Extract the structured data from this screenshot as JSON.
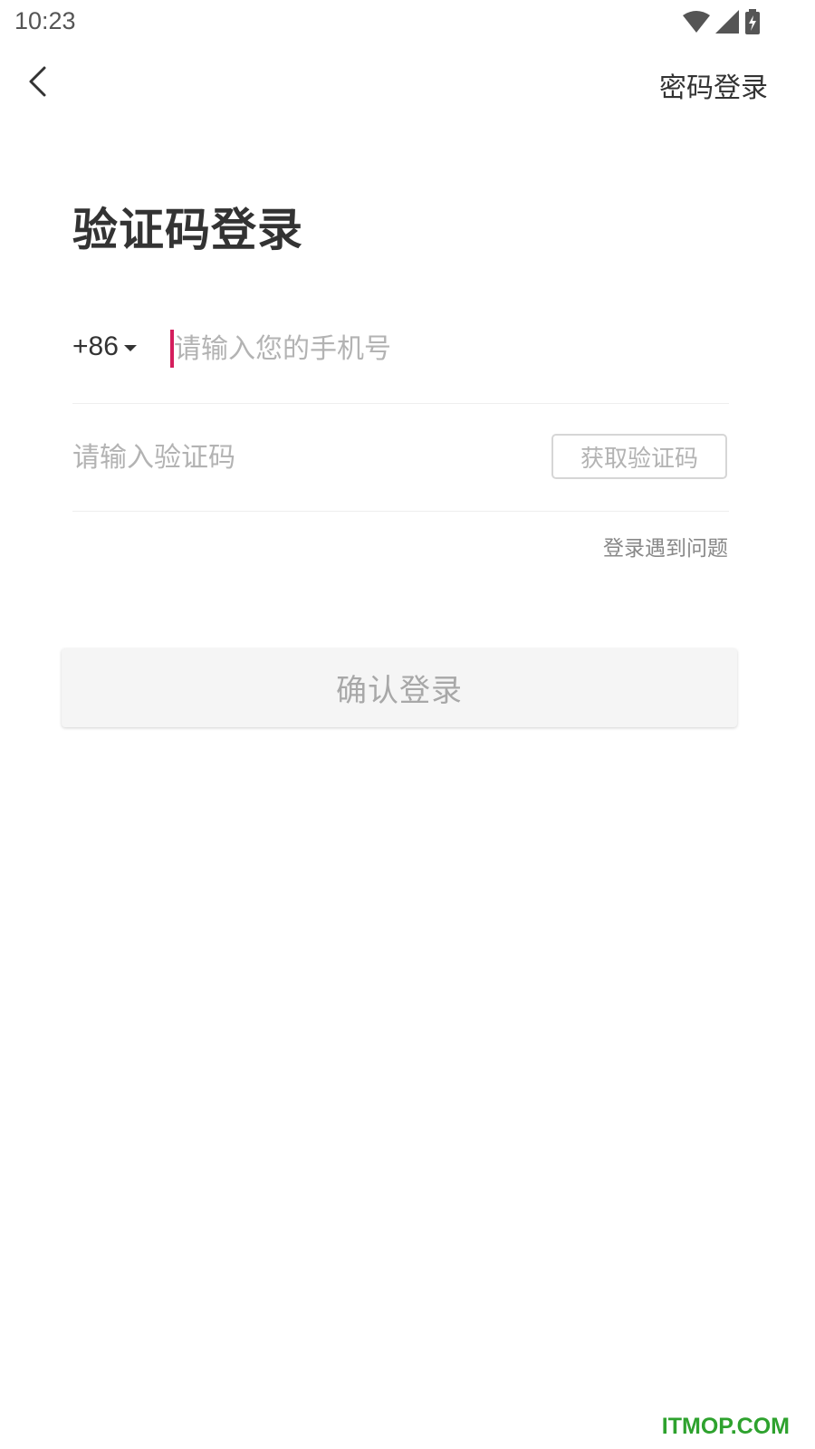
{
  "status_bar": {
    "time": "10:23",
    "icons": [
      "wifi-icon",
      "signal-icon",
      "battery-charging-icon"
    ]
  },
  "header": {
    "back_icon": "chevron-left-icon",
    "password_login_label": "密码登录"
  },
  "page": {
    "title": "验证码登录"
  },
  "phone_field": {
    "country_code": "+86",
    "placeholder": "请输入您的手机号",
    "value": ""
  },
  "code_field": {
    "placeholder": "请输入验证码",
    "value": "",
    "get_code_label": "获取验证码"
  },
  "help_link_label": "登录遇到问题",
  "confirm_label": "确认登录",
  "watermark": "ITMOP.COM",
  "colors": {
    "cursor_accent": "#d41e5c",
    "watermark": "#2ea22e"
  }
}
